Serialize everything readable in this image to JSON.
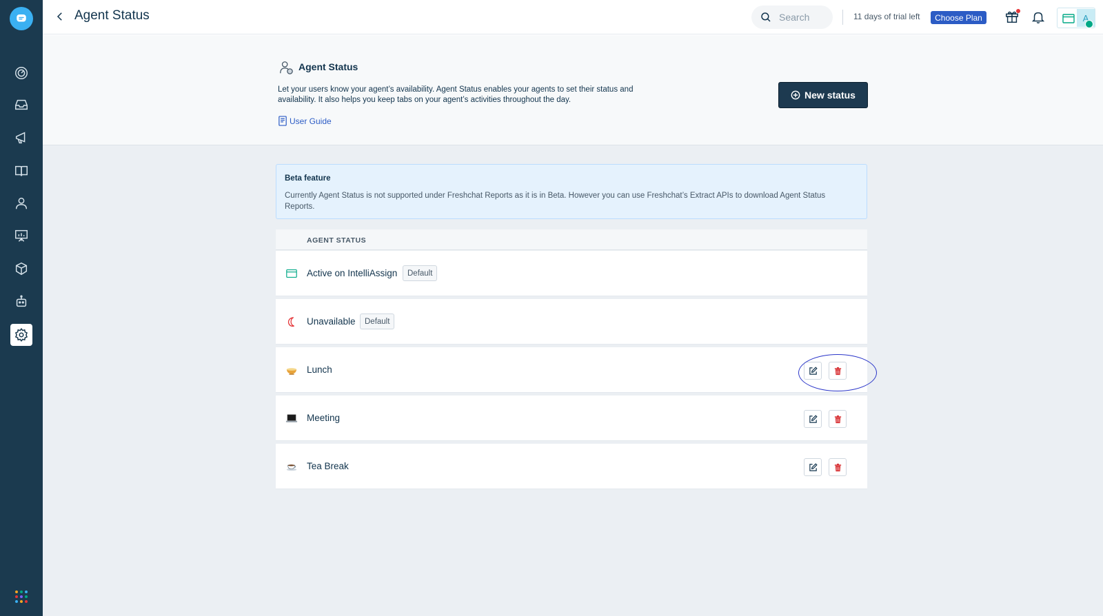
{
  "header": {
    "title": "Agent Status",
    "search_placeholder": "Search",
    "trial_text": "11 days of trial left",
    "choose_plan_label": "Choose Plan",
    "avatar_initial": "A"
  },
  "sidebar": {
    "items": [
      {
        "icon": "dashboard-icon"
      },
      {
        "icon": "inbox-icon"
      },
      {
        "icon": "campaigns-icon"
      },
      {
        "icon": "knowledge-base-icon"
      },
      {
        "icon": "contacts-icon"
      },
      {
        "icon": "reports-icon"
      },
      {
        "icon": "integrations-icon"
      },
      {
        "icon": "bots-icon"
      },
      {
        "icon": "settings-icon",
        "active": true
      }
    ]
  },
  "intro": {
    "title": "Agent Status",
    "description": "Let your users know your agent’s availability. Agent Status enables your agents to set their status and availability. It also helps you keep tabs on your agent’s activities throughout the day.",
    "guide_label": "User Guide",
    "new_status_label": "New status"
  },
  "beta": {
    "title": "Beta feature",
    "text": "Currently Agent Status is not supported under Freshchat Reports as it is in Beta. However you can use Freshchat’s Extract APIs to download Agent Status Reports."
  },
  "table": {
    "header": "AGENT STATUS",
    "rows": [
      {
        "label": "Active on IntelliAssign",
        "badge": "Default",
        "icon": "intelliassign-icon"
      },
      {
        "label": "Unavailable",
        "badge": "Default",
        "icon": "moon-icon"
      },
      {
        "label": "Lunch",
        "icon": "ramen-bowl-icon",
        "actions": true
      },
      {
        "label": "Meeting",
        "icon": "laptop-icon",
        "actions": true
      },
      {
        "label": "Tea Break",
        "icon": "tea-cup-icon",
        "actions": true
      }
    ]
  },
  "colors": {
    "sidebar": "#1b3a4f",
    "primary_button": "#1d3a50",
    "plan_button": "#2c5cc5",
    "delete_red": "#d72d30",
    "annotation_oval": "#2a35c9"
  }
}
